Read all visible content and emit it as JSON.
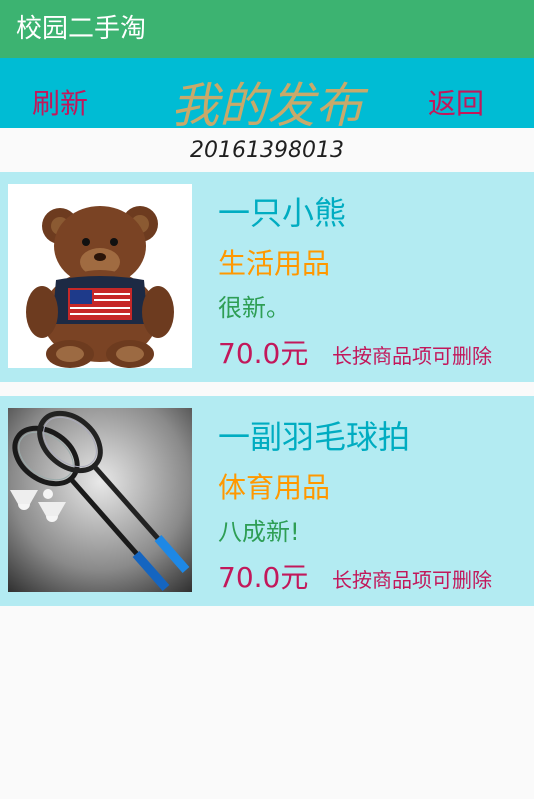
{
  "app": {
    "title": "校园二手淘"
  },
  "toolbar": {
    "refresh_label": "刷新",
    "title": "我的发布",
    "back_label": "返回"
  },
  "user": {
    "id": "20161398013"
  },
  "listings": [
    {
      "name": "一只小熊",
      "category": "生活用品",
      "description": "很新。",
      "price": "70.0元",
      "hint": "长按商品项可删除",
      "image_icon": "teddy-bear-photo"
    },
    {
      "name": "一副羽毛球拍",
      "category": "体育用品",
      "description": "八成新!",
      "price": "70.0元",
      "hint": "长按商品项可删除",
      "image_icon": "badminton-rackets-photo"
    }
  ],
  "colors": {
    "statusbar": "#3cb371",
    "toolbar": "#00bcd4",
    "list_item_bg": "#b3ebf2",
    "accent_red": "#c2185b",
    "title_gold": "#c8a96a",
    "name_teal": "#00acc1",
    "category_orange": "#ff9800",
    "description_green": "#2e9e55"
  }
}
